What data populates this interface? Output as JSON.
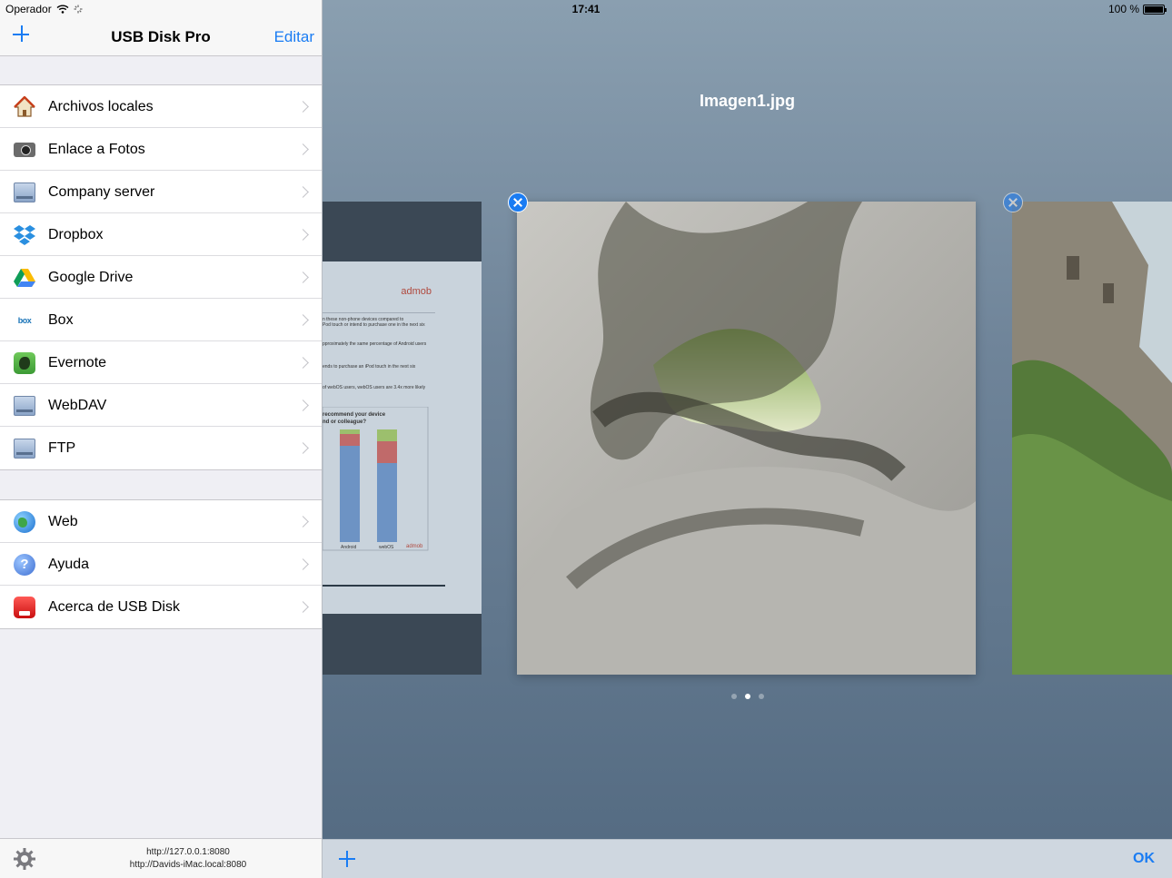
{
  "status_bar": {
    "carrier": "Operador",
    "time": "17:41",
    "battery": "100 %"
  },
  "sidebar": {
    "title": "USB Disk Pro",
    "edit_label": "Editar",
    "group1": [
      {
        "label": "Archivos locales",
        "icon": "house-icon"
      },
      {
        "label": "Enlace a Fotos",
        "icon": "camera-icon"
      },
      {
        "label": "Company server",
        "icon": "server-icon"
      },
      {
        "label": "Dropbox",
        "icon": "dropbox-icon"
      },
      {
        "label": "Google Drive",
        "icon": "google-drive-icon"
      },
      {
        "label": "Box",
        "icon": "box-icon"
      },
      {
        "label": "Evernote",
        "icon": "evernote-icon"
      },
      {
        "label": "WebDAV",
        "icon": "server-icon"
      },
      {
        "label": "FTP",
        "icon": "server-icon"
      }
    ],
    "group2": [
      {
        "label": "Web",
        "icon": "globe-icon"
      },
      {
        "label": "Ayuda",
        "icon": "help-icon"
      },
      {
        "label": "Acerca de USB Disk",
        "icon": "usb-disk-icon"
      }
    ],
    "box_icon_text": "box",
    "help_icon_text": "?",
    "footer": {
      "url_local": "http://127.0.0.1:8080",
      "url_network": "http://Davids-iMac.local:8080"
    }
  },
  "main": {
    "title": "Imagen1.jpg",
    "page_count": 3,
    "current_page": 2,
    "ok_label": "OK",
    "doc_preview": {
      "brand": "admob",
      "lines": [
        "n these non-phone devices compared to",
        "Pod touch or intend to purchase one in the next six",
        "pproximately the same percentage of Android users",
        "ends to purchase an iPod touch in the next six",
        "of webOS users, webOS users are 3.4x more likely",
        "recommend your device",
        "nd or colleague?",
        "Android",
        "webOS",
        "admob"
      ]
    }
  },
  "colors": {
    "accent": "#1a7cf3"
  }
}
